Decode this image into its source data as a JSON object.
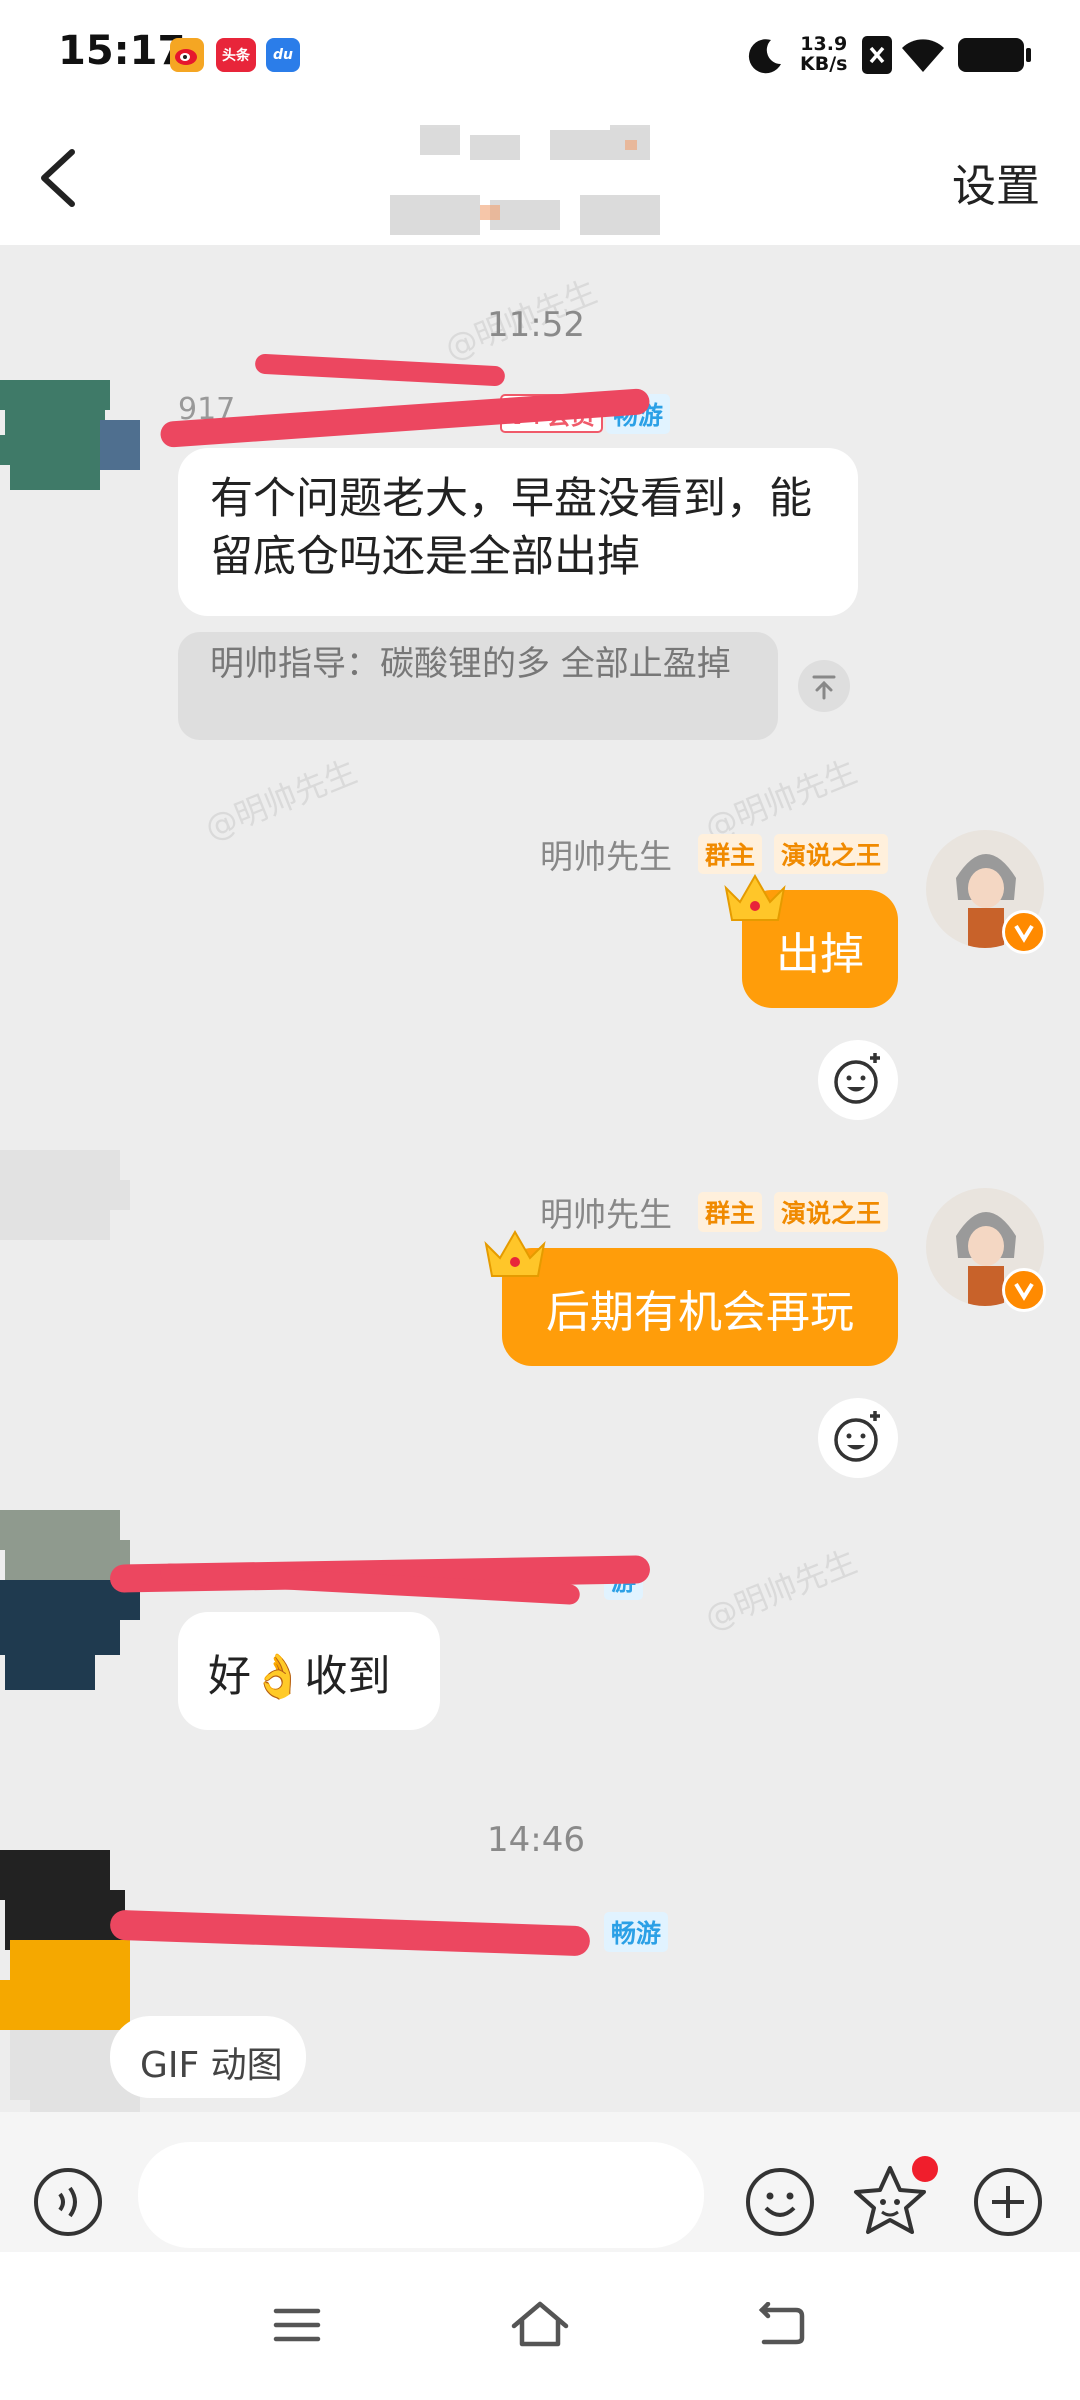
{
  "status_bar": {
    "time": "15:17",
    "apps": [
      {
        "icon": "weibo-app-icon",
        "text": ""
      },
      {
        "icon": "toutiao-app-icon",
        "text": "头条"
      },
      {
        "icon": "du-app-icon",
        "text": "du"
      }
    ],
    "net_speed_value": "13.9",
    "net_speed_unit": "KB/s"
  },
  "nav": {
    "back_icon": "chevron-left-icon",
    "settings_label": "设置"
  },
  "messages": {
    "time_1": "11:52",
    "msg1": {
      "sender_prefix": "917",
      "badge_vip": "V+会员",
      "badge_tour": "畅游",
      "text": "有个问题老大，早盘没看到，能留底仓吗还是全部出掉",
      "quote": "明帅指导：碳酸锂的多 全部止盈掉"
    },
    "msg2": {
      "name": "明帅先生",
      "badge_owner": "群主",
      "badge_speech": "演说之王",
      "text": "出掉"
    },
    "msg3": {
      "name": "明帅先生",
      "badge_owner": "群主",
      "badge_speech": "演说之王",
      "text": "后期有机会再玩"
    },
    "msg4": {
      "badge_tour": "游",
      "text": "好👌收到"
    },
    "time_2": "14:46",
    "msg5": {
      "badge_tour": "畅游",
      "text": "GIF 动图"
    }
  },
  "watermark": "@明帅先生",
  "input": {
    "placeholder": "",
    "voice_icon": "voice-icon",
    "emoji_icon": "emoji-icon",
    "sticker_icon": "sticker-icon",
    "add_icon": "plus-icon"
  },
  "system_nav": {
    "menu_icon": "menu-icon",
    "home_icon": "home-icon",
    "back_icon": "back-icon"
  },
  "colors": {
    "accent_orange": "#ff9d0a",
    "bg": "#ededed",
    "redact": "#ec4760"
  }
}
